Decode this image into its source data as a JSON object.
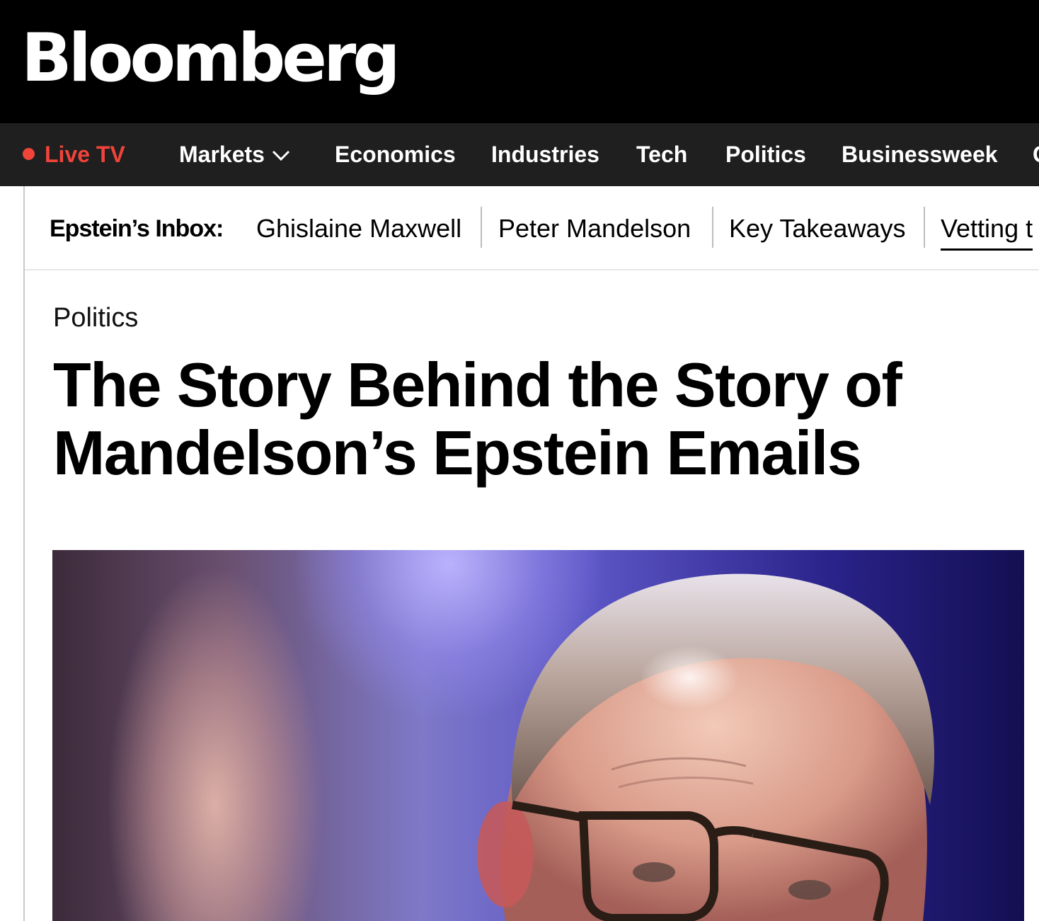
{
  "brand": {
    "logo": "Bloomberg"
  },
  "nav": {
    "live_tv": "Live TV",
    "items": [
      "Markets",
      "Economics",
      "Industries",
      "Tech",
      "Politics",
      "Businessweek",
      "C"
    ]
  },
  "sub_nav": {
    "label": "Epstein’s Inbox:",
    "links": [
      "Ghislaine Maxwell",
      "Peter Mandelson",
      "Key Takeaways",
      "Vetting t"
    ]
  },
  "article": {
    "section": "Politics",
    "headline_line1": "The Story Behind the Story of",
    "headline_line2": "Mandelson’s Epstein Emails"
  },
  "colors": {
    "live_red": "#f0443a",
    "nav_bg": "#1f1f1f",
    "brand_bg": "#000000"
  },
  "icons": {
    "markets_dropdown": "chevron-down-icon",
    "live_indicator": "live-dot-icon"
  }
}
